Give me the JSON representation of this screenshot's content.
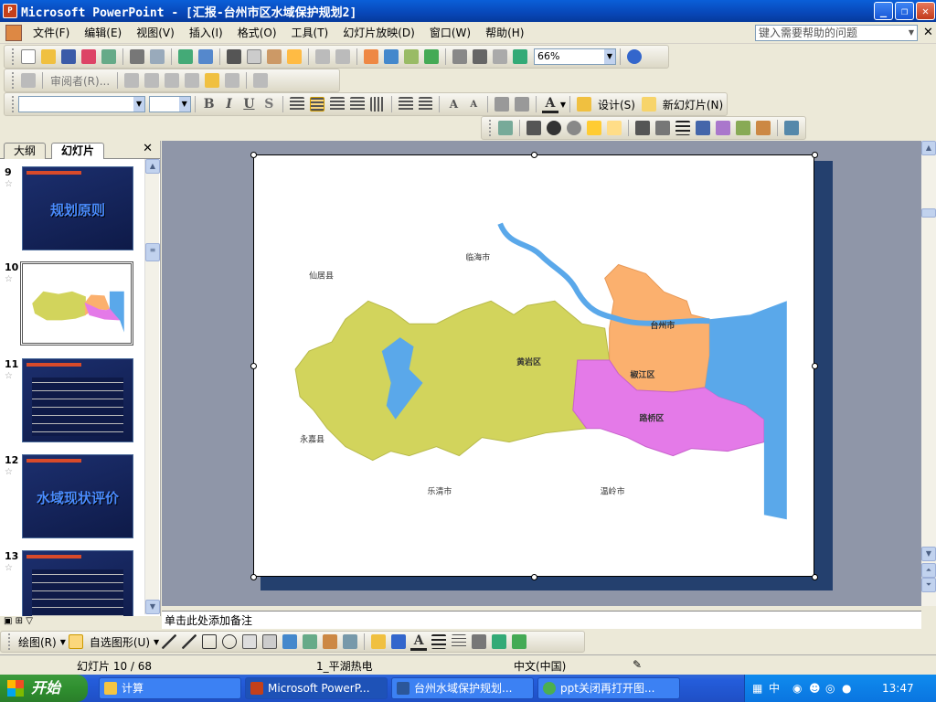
{
  "window": {
    "title": "Microsoft PowerPoint - [汇报-台州市区水域保护规划2]",
    "app_icon": "P"
  },
  "menu": [
    "文件(F)",
    "编辑(E)",
    "视图(V)",
    "插入(I)",
    "格式(O)",
    "工具(T)",
    "幻灯片放映(D)",
    "窗口(W)",
    "帮助(H)"
  ],
  "help_placeholder": "键入需要帮助的问题",
  "toolbar": {
    "zoom": "66%",
    "reviewer": "审阅者(R)...",
    "design": "设计(S)",
    "new_slide": "新幻灯片(N)"
  },
  "panel": {
    "tabs": [
      "大纲",
      "幻灯片"
    ],
    "active_tab": "幻灯片"
  },
  "slides": [
    {
      "num": "9",
      "title": "规划原则"
    },
    {
      "num": "10",
      "title": ""
    },
    {
      "num": "11",
      "title": ""
    },
    {
      "num": "12",
      "title": "水域现状评价"
    },
    {
      "num": "13",
      "title": ""
    }
  ],
  "map": {
    "labels": {
      "linhai": "临海市",
      "xianju": "仙居县",
      "taizhou": "台州市",
      "huangyan": "黄岩区",
      "jiaojiang": "椒江区",
      "luqiao": "路桥区",
      "yongjia": "永嘉县",
      "yueqing": "乐清市",
      "wenling": "温岭市"
    },
    "colors": {
      "huangyan": "#d2d45c",
      "jiaojiang": "#fbb06e",
      "luqiao": "#e47ae8",
      "water": "#5aa8ea"
    }
  },
  "notes_placeholder": "单击此处添加备注",
  "drawbar": {
    "draw": "绘图(R)",
    "autoshape": "自选图形(U)"
  },
  "status": {
    "slide": "幻灯片 10 / 68",
    "design": "1_平湖热电",
    "lang": "中文(中国)"
  },
  "taskbar": {
    "start": "开始",
    "items": [
      "计算",
      "Microsoft PowerP...",
      "台州水域保护规划...",
      "ppt关闭再打开图..."
    ],
    "clock": "13:47",
    "ime": "中"
  }
}
